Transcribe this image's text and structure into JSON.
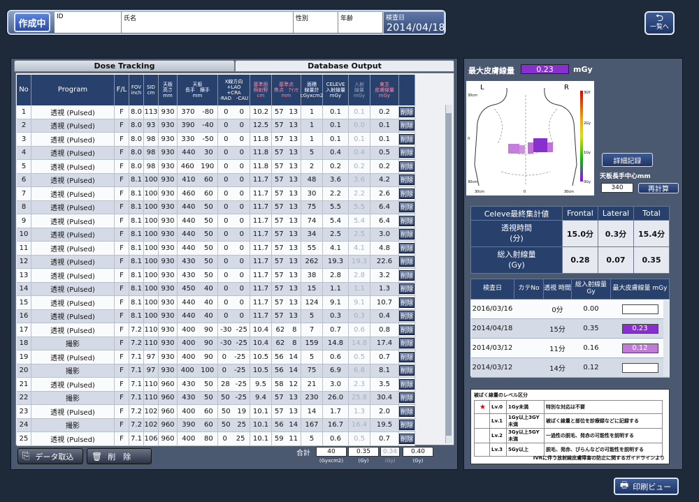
{
  "header": {
    "status_label": "作成中",
    "fields": [
      {
        "label": "ID",
        "value": ""
      },
      {
        "label": "氏名",
        "value": ""
      },
      {
        "label": "性別",
        "value": ""
      },
      {
        "label": "年齢",
        "value": ""
      }
    ],
    "exam_date_label": "検査日",
    "exam_date": "2014/04/18",
    "back_label": "一覧へ"
  },
  "tabs": [
    "Dose Tracking",
    "Database Output"
  ],
  "table": {
    "columns": [
      {
        "lines": [
          "No"
        ]
      },
      {
        "lines": [
          "Program"
        ]
      },
      {
        "lines": [
          "F/L"
        ]
      },
      {
        "lines": [
          "FOV",
          "inch"
        ]
      },
      {
        "lines": [
          "SID",
          "cm"
        ]
      },
      {
        "lines": [
          "天板",
          "高さ",
          "mm"
        ]
      },
      {
        "lines": [
          "天板",
          "長手　横手",
          "mm"
        ]
      },
      {
        "lines": [
          "X線方向",
          "+LAO　+CRA",
          "-RAO　-CAU"
        ]
      },
      {
        "lines": [
          "基準面",
          "照射野",
          "cm"
        ]
      },
      {
        "lines": [
          "基準点",
          "焦点　ｱｲｿｾ",
          "mm"
        ]
      },
      {
        "lines": [
          "面積",
          "線量計",
          "cGyxcm2"
        ]
      },
      {
        "lines": [
          "CELEVE",
          "入射線量",
          "mGy"
        ]
      },
      {
        "lines": [
          "入射",
          "線量",
          "mGy"
        ]
      },
      {
        "lines": [
          "東芝",
          "皮膚線量",
          "mGy"
        ]
      },
      {
        "lines": [
          ""
        ]
      }
    ],
    "delete_label": "削除",
    "rows": [
      [
        "1",
        "透視 (Pulsed)",
        "F",
        "8.0",
        "113",
        "930",
        "370",
        "-80",
        "0",
        "0",
        "10.2",
        "57",
        "13",
        "1",
        "0.1",
        "0.1",
        "0.2"
      ],
      [
        "2",
        "透視 (Pulsed)",
        "F",
        "8.0",
        "93",
        "930",
        "390",
        "-40",
        "0",
        "0",
        "12.5",
        "57",
        "13",
        "1",
        "0.1",
        "0.0",
        "0.1"
      ],
      [
        "3",
        "透視 (Pulsed)",
        "F",
        "8.0",
        "98",
        "930",
        "330",
        "-50",
        "0",
        "0",
        "11.8",
        "57",
        "13",
        "1",
        "0.1",
        "0.1",
        "0.1"
      ],
      [
        "4",
        "透視 (Pulsed)",
        "F",
        "8.0",
        "98",
        "930",
        "440",
        "30",
        "0",
        "0",
        "11.8",
        "57",
        "13",
        "5",
        "0.4",
        "0.4",
        "0.5"
      ],
      [
        "5",
        "透視 (Pulsed)",
        "F",
        "8.0",
        "98",
        "930",
        "460",
        "190",
        "0",
        "0",
        "11.8",
        "57",
        "13",
        "2",
        "0.2",
        "0.2",
        "0.2"
      ],
      [
        "6",
        "透視 (Pulsed)",
        "F",
        "8.1",
        "100",
        "930",
        "410",
        "60",
        "0",
        "0",
        "11.7",
        "57",
        "13",
        "48",
        "3.6",
        "3.6",
        "4.2"
      ],
      [
        "7",
        "透視 (Pulsed)",
        "F",
        "8.1",
        "100",
        "930",
        "460",
        "60",
        "0",
        "0",
        "11.7",
        "57",
        "13",
        "30",
        "2.2",
        "2.2",
        "2.6"
      ],
      [
        "8",
        "透視 (Pulsed)",
        "F",
        "8.1",
        "100",
        "930",
        "440",
        "50",
        "0",
        "0",
        "11.7",
        "57",
        "13",
        "75",
        "5.5",
        "5.5",
        "6.4"
      ],
      [
        "9",
        "透視 (Pulsed)",
        "F",
        "8.1",
        "100",
        "930",
        "440",
        "50",
        "0",
        "0",
        "11.7",
        "57",
        "13",
        "74",
        "5.4",
        "5.4",
        "6.4"
      ],
      [
        "10",
        "透視 (Pulsed)",
        "F",
        "8.1",
        "100",
        "930",
        "440",
        "50",
        "0",
        "0",
        "11.7",
        "57",
        "13",
        "34",
        "2.5",
        "2.5",
        "3.0"
      ],
      [
        "11",
        "透視 (Pulsed)",
        "F",
        "8.1",
        "100",
        "930",
        "440",
        "50",
        "0",
        "0",
        "11.7",
        "57",
        "13",
        "55",
        "4.1",
        "4.1",
        "4.8"
      ],
      [
        "12",
        "透視 (Pulsed)",
        "F",
        "8.1",
        "100",
        "930",
        "430",
        "50",
        "0",
        "0",
        "11.7",
        "57",
        "13",
        "262",
        "19.3",
        "19.3",
        "22.6"
      ],
      [
        "13",
        "透視 (Pulsed)",
        "F",
        "8.1",
        "100",
        "930",
        "430",
        "50",
        "0",
        "0",
        "11.7",
        "57",
        "13",
        "38",
        "2.8",
        "2.8",
        "3.2"
      ],
      [
        "14",
        "透視 (Pulsed)",
        "F",
        "8.1",
        "100",
        "930",
        "450",
        "40",
        "0",
        "0",
        "11.7",
        "57",
        "13",
        "15",
        "1.1",
        "1.1",
        "1.3"
      ],
      [
        "15",
        "透視 (Pulsed)",
        "F",
        "8.1",
        "100",
        "930",
        "440",
        "40",
        "0",
        "0",
        "11.7",
        "57",
        "13",
        "124",
        "9.1",
        "9.1",
        "10.7"
      ],
      [
        "16",
        "透視 (Pulsed)",
        "F",
        "8.1",
        "100",
        "930",
        "440",
        "40",
        "0",
        "0",
        "11.7",
        "57",
        "13",
        "5",
        "0.3",
        "0.3",
        "0.4"
      ],
      [
        "17",
        "透視 (Pulsed)",
        "F",
        "7.2",
        "110",
        "930",
        "400",
        "90",
        "-30",
        "-25",
        "10.4",
        "62",
        "8",
        "7",
        "0.7",
        "0.6",
        "0.8"
      ],
      [
        "18",
        "撮影",
        "F",
        "7.2",
        "110",
        "930",
        "400",
        "90",
        "-30",
        "-25",
        "10.4",
        "62",
        "8",
        "159",
        "14.8",
        "14.8",
        "17.4"
      ],
      [
        "19",
        "透視 (Pulsed)",
        "F",
        "7.1",
        "97",
        "930",
        "400",
        "90",
        "0",
        "-25",
        "10.5",
        "56",
        "14",
        "5",
        "0.6",
        "0.5",
        "0.7"
      ],
      [
        "20",
        "撮影",
        "F",
        "7.1",
        "97",
        "930",
        "400",
        "100",
        "0",
        "-25",
        "10.5",
        "56",
        "14",
        "75",
        "6.9",
        "6.8",
        "8.1"
      ],
      [
        "21",
        "透視 (Pulsed)",
        "F",
        "7.1",
        "110",
        "960",
        "430",
        "50",
        "28",
        "-25",
        "9.5",
        "58",
        "12",
        "21",
        "3.0",
        "2.3",
        "3.5"
      ],
      [
        "22",
        "撮影",
        "F",
        "7.1",
        "110",
        "960",
        "430",
        "50",
        "50",
        "-25",
        "9.4",
        "57",
        "13",
        "230",
        "26.0",
        "25.8",
        "30.4"
      ],
      [
        "23",
        "透視 (Pulsed)",
        "F",
        "7.2",
        "102",
        "960",
        "400",
        "60",
        "50",
        "19",
        "10.1",
        "57",
        "13",
        "14",
        "1.7",
        "1.3",
        "2.0"
      ],
      [
        "24",
        "撮影",
        "F",
        "7.2",
        "102",
        "960",
        "390",
        "60",
        "50",
        "25",
        "10.1",
        "56",
        "14",
        "167",
        "16.7",
        "16.4",
        "19.5"
      ],
      [
        "25",
        "透視 (Pulsed)",
        "F",
        "7.1",
        "106",
        "960",
        "400",
        "80",
        "0",
        "25",
        "10.1",
        "59",
        "11",
        "5",
        "0.6",
        "0.5",
        "0.7"
      ]
    ]
  },
  "bottom_left": {
    "import_label": "データ取込",
    "delete_label": "削　除",
    "total_label": "合計",
    "totals": [
      "40",
      "0.35",
      "0.34",
      "0.40"
    ],
    "total_units": [
      "(Gyxcm2)",
      "(Gy)",
      "(Gy)",
      "(Gy)"
    ]
  },
  "right": {
    "max_skin_dose_label": "最大皮膚線量",
    "max_skin_dose_value": "0.23",
    "max_skin_dose_unit": "mGy",
    "bodymap": {
      "left_label": "L",
      "right_label": "R",
      "scale_ticks": [
        "3GY",
        "2Gy",
        "1Gy",
        "0Gy"
      ],
      "dim_labels": [
        "30cm",
        "0",
        "30cm",
        "30cm",
        "0",
        "30cm"
      ]
    },
    "detail_button": "詳細記録",
    "table_center_label": "天板長手中心mm",
    "table_center_value": "340",
    "recalc_button": "再計算"
  },
  "celeve_summary": {
    "headers": [
      "Celeve最終集計値",
      "Frontal",
      "Lateral",
      "Total"
    ],
    "rows": [
      {
        "label_1": "透視時間",
        "label_2": "(分)",
        "values": [
          "15.0分",
          "0.3分",
          "15.4分"
        ]
      },
      {
        "label_1": "総入射線量",
        "label_2": "(Gy)",
        "values": [
          "0.28",
          "0.07",
          "0.35"
        ]
      }
    ]
  },
  "history": {
    "headers": [
      "検査日",
      "カテNo",
      "透視 時間",
      "総入射線量 Gy",
      "最大皮膚線量 mGy"
    ],
    "rows": [
      {
        "date": "2016/03/16",
        "cath": "",
        "time": "0分",
        "total": "0.00",
        "max": "",
        "color": "#ffffff"
      },
      {
        "date": "2014/04/18",
        "cath": "",
        "time": "15分",
        "total": "0.35",
        "max": "0.23",
        "color": "#8a2fcf"
      },
      {
        "date": "2014/03/12",
        "cath": "",
        "time": "11分",
        "total": "0.16",
        "max": "0.12",
        "color": "#c27ad8"
      },
      {
        "date": "2014/03/12",
        "cath": "",
        "time": "14分",
        "total": "0.12",
        "max": "",
        "color": "#ffffff"
      }
    ]
  },
  "legend": {
    "title": "被ばく線量のレベル区分",
    "rows": [
      {
        "mark": "★",
        "level": "Lv.0",
        "range": "1Gy未満",
        "desc": "特別な対応は不要"
      },
      {
        "mark": "",
        "level": "Lv.1",
        "range": "1Gy以上3GY未満",
        "desc": "被ばく線量と部位を診療録などに記録する"
      },
      {
        "mark": "",
        "level": "Lv.2",
        "range": "3Gy以上5GY未満",
        "desc": "一過性の脱毛、発赤の可能性を説明する"
      },
      {
        "mark": "",
        "level": "Lv.3",
        "range": "5Gy以上",
        "desc": "脱毛、発赤、びらんなどの可能性を説明する"
      }
    ],
    "footer": "IVRに伴う放射線皮膚障害の防止に関するガイドラインより"
  },
  "print_label": "印刷ビュー"
}
